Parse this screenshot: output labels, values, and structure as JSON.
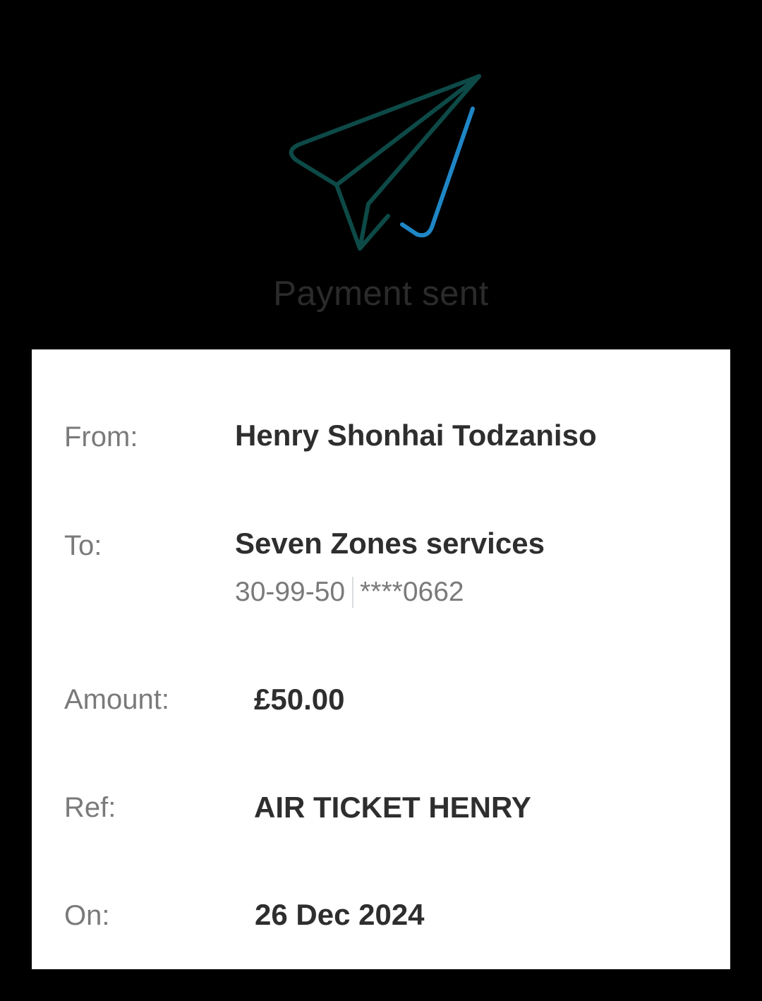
{
  "header": {
    "icon": "paper-plane-check-icon",
    "title": "Payment sent",
    "colors": {
      "plane": "#0d4a47",
      "check": "#1f86c6"
    }
  },
  "details": {
    "from_label": "From:",
    "from_value": "Henry Shonhai Todzaniso",
    "to_label": "To:",
    "to_value": "Seven Zones services",
    "sort_code": "30-99-50",
    "account_number": "****0662",
    "amount_label": "Amount:",
    "amount_value": "£50.00",
    "ref_label": "Ref:",
    "ref_value": "AIR TICKET HENRY",
    "on_label": "On:",
    "on_value": "26 Dec 2024"
  }
}
